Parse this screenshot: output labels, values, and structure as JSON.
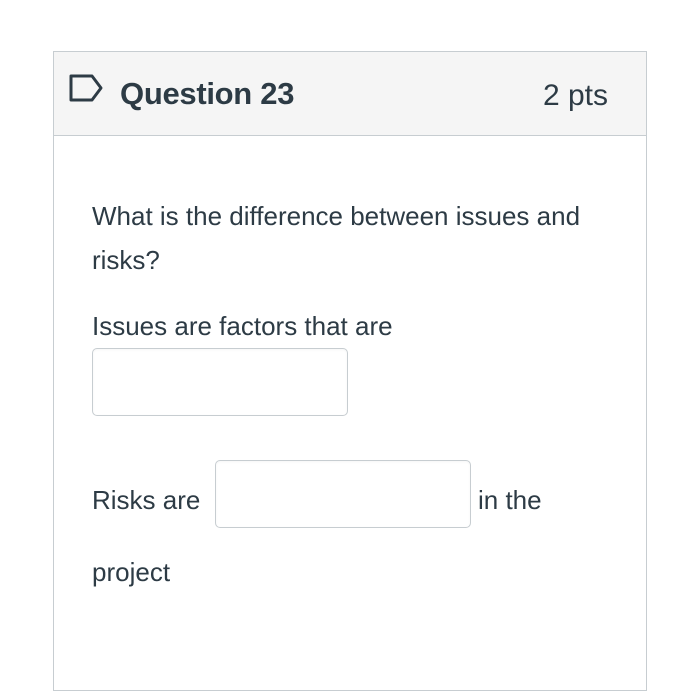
{
  "question": {
    "title": "Question 23",
    "points": "2 pts",
    "flag_icon": "bookmark-flag-icon",
    "text": "What is the difference between issues and risks?",
    "issues_prefix": "Issues are factors that are",
    "issues_answer": "",
    "risks_prefix": "Risks are",
    "risks_answer": "",
    "risks_suffix": "in the",
    "risks_tail": "project"
  },
  "colors": {
    "header_background": "#f5f5f5",
    "border": "#c7cdd1",
    "text": "#2d3b45",
    "flag_outline": "#2d3b45"
  }
}
